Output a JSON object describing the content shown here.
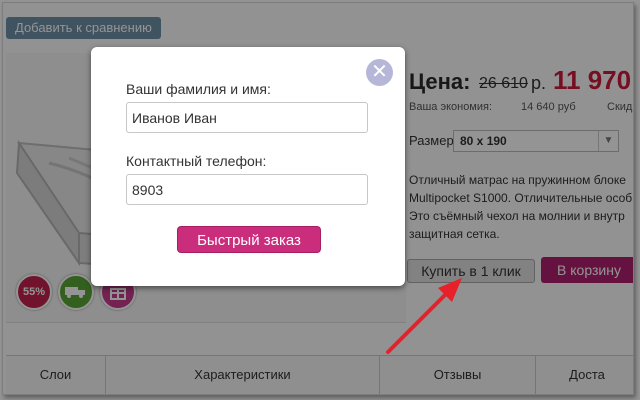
{
  "compare_button": "Добавить к сравнению",
  "price": {
    "label": "Цена:",
    "old": "26 610",
    "rub": "р.",
    "new": "11 970",
    "saving_label": "Ваша экономия:",
    "saving_value": "14 640 руб",
    "discount_label": "Скид"
  },
  "size": {
    "label": "Размер",
    "value": "80 х 190"
  },
  "description": [
    "Отличный матрас на пружинном блоке",
    "Multipocket S1000. Отличительные особ",
    "Это съёмный чехол на молнии и внутр",
    "защитная сетка."
  ],
  "buttons": {
    "buy_one_click": "Купить в 1 клик",
    "to_cart": "В корзину"
  },
  "badges": {
    "discount": "55%"
  },
  "tabs": [
    "Слои",
    "Характеристики",
    "Отзывы",
    "Доста"
  ],
  "modal": {
    "name_label": "Ваши фамилия и имя:",
    "name_value": "Иванов Иван",
    "phone_label": "Контактный телефон:",
    "phone_value": "8903",
    "submit_label": "Быстрый заказ",
    "close_icon": "close-icon"
  },
  "colors": {
    "accent": "#c92d7c",
    "price_new": "#cc1b3b",
    "arrow": "#e8202a"
  }
}
